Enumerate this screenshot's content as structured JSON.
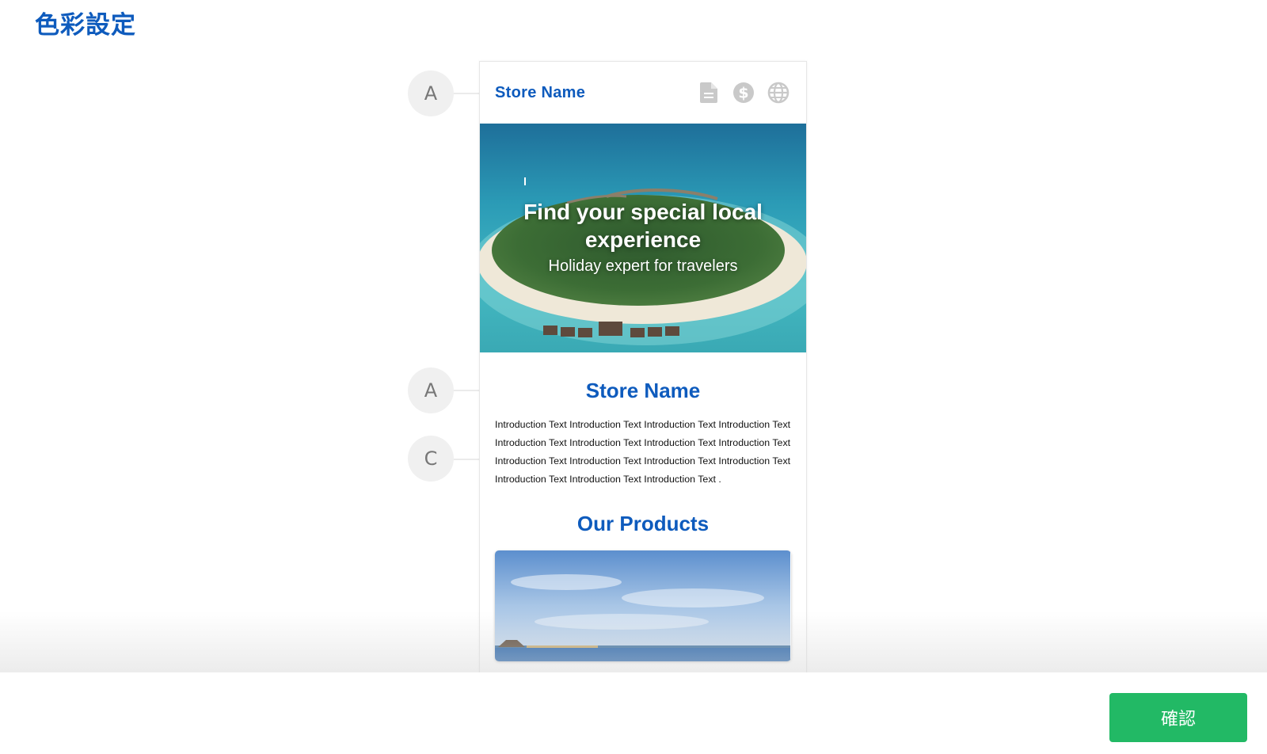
{
  "page": {
    "title": "色彩設定"
  },
  "markers": {
    "header": "A",
    "store_name": "A",
    "intro": "C"
  },
  "preview": {
    "header": {
      "store_name": "Store Name",
      "icons": [
        "document-icon",
        "dollar-icon",
        "globe-icon"
      ]
    },
    "hero": {
      "title": "Find your special local experience",
      "subtitle": "Holiday expert for travelers"
    },
    "store_name": "Store Name",
    "intro_text": "Introduction Text Introduction Text Introduction Text Introduction Text Introduction Text Introduction Text Introduction Text Introduction Text Introduction Text Introduction Text Introduction Text Introduction Text Introduction Text Introduction Text Introduction Text .",
    "products_title": "Our Products"
  },
  "footer": {
    "confirm_label": "確認"
  },
  "colors": {
    "primary": "#0e5bbd",
    "confirm": "#22b965",
    "marker_bg": "#f0f0f0",
    "icon_gray": "#c9c9c9"
  }
}
